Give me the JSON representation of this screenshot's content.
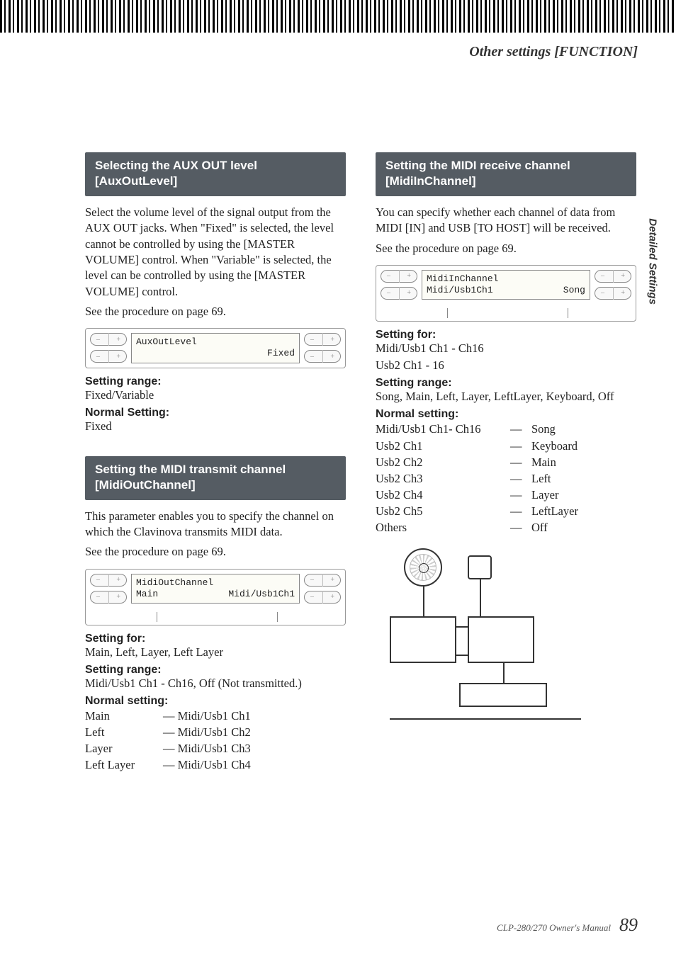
{
  "header": {
    "title": "Other settings [FUNCTION]"
  },
  "side_tab": "Detailed Settings",
  "footer": {
    "manual": "CLP-280/270 Owner's Manual",
    "page": "89"
  },
  "left": {
    "aux": {
      "heading": "Selecting the AUX OUT level [AuxOutLevel]",
      "body": "Select the volume level of the signal output from the AUX OUT jacks. When \"Fixed\" is selected, the level cannot be controlled by using the [MASTER VOLUME] control. When \"Variable\" is selected, the level can be controlled by using the [MASTER VOLUME] control.",
      "see": "See the procedure on page 69.",
      "lcd": {
        "line1": "AuxOutLevel",
        "line2": "Fixed"
      },
      "range_label": "Setting range:",
      "range": "Fixed/Variable",
      "normal_label": "Normal Setting:",
      "normal": "Fixed"
    },
    "midiout": {
      "heading": "Setting the MIDI transmit channel [MidiOutChannel]",
      "body": "This parameter enables you to specify the channel on which the Clavinova transmits MIDI data.",
      "see": "See the procedure on page 69.",
      "lcd": {
        "line1": "MidiOutChannel",
        "line2_left": "Main",
        "line2_right": "Midi/Usb1Ch1"
      },
      "for_label": "Setting for:",
      "for": "Main, Left, Layer, Left Layer",
      "range_label": "Setting range:",
      "range": "Midi/Usb1 Ch1 - Ch16, Off (Not transmitted.)",
      "normal_label": "Normal setting:",
      "rows": [
        {
          "a": "Main",
          "b": "— Midi/Usb1 Ch1"
        },
        {
          "a": "Left",
          "b": "— Midi/Usb1 Ch2"
        },
        {
          "a": "Layer",
          "b": "— Midi/Usb1 Ch3"
        },
        {
          "a": "Left Layer",
          "b": "— Midi/Usb1 Ch4"
        }
      ]
    }
  },
  "right": {
    "midiin": {
      "heading": "Setting the MIDI receive channel [MidiInChannel]",
      "body": "You can specify whether each channel of data from MIDI [IN] and USB [TO HOST] will be received.",
      "see": "See the procedure on page 69.",
      "lcd": {
        "line1": "MidiInChannel",
        "line2_left": "Midi/Usb1Ch1",
        "line2_right": "Song"
      },
      "for_label": "Setting for:",
      "for1": "Midi/Usb1 Ch1 - Ch16",
      "for2": "Usb2 Ch1 - 16",
      "range_label": "Setting range:",
      "range": "Song, Main, Left, Layer, LeftLayer, Keyboard, Off",
      "normal_label": "Normal setting:",
      "rows": [
        {
          "a": "Midi/Usb1 Ch1- Ch16",
          "b": "—",
          "c": "Song"
        },
        {
          "a": "Usb2 Ch1",
          "b": "—",
          "c": "Keyboard"
        },
        {
          "a": "Usb2 Ch2",
          "b": "—",
          "c": "Main"
        },
        {
          "a": "Usb2 Ch3",
          "b": "—",
          "c": "Left"
        },
        {
          "a": "Usb2 Ch4",
          "b": "—",
          "c": "Layer"
        },
        {
          "a": "Usb2 Ch5",
          "b": "—",
          "c": "LeftLayer"
        },
        {
          "a": "Others",
          "b": "—",
          "c": "Off"
        }
      ]
    }
  }
}
